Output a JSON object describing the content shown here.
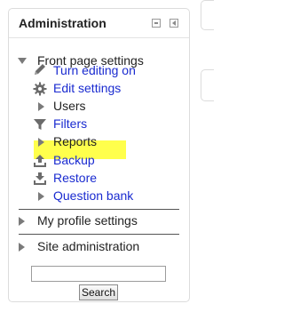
{
  "block": {
    "title": "Administration",
    "front_page": {
      "label": "Front page settings",
      "items": [
        {
          "label": "Turn editing on",
          "icon": "pencil-icon"
        },
        {
          "label": "Edit settings",
          "icon": "gear-icon"
        },
        {
          "label": "Users",
          "icon": "expand-arrow-icon"
        },
        {
          "label": "Filters",
          "icon": "funnel-icon"
        },
        {
          "label": "Reports",
          "icon": "expand-arrow-icon"
        },
        {
          "label": "Backup",
          "icon": "upload-icon"
        },
        {
          "label": "Restore",
          "icon": "download-icon"
        },
        {
          "label": "Question bank",
          "icon": "expand-arrow-icon"
        }
      ]
    },
    "my_profile": {
      "label": "My profile settings"
    },
    "site_admin": {
      "label": "Site administration"
    },
    "search": {
      "button_label": "Search",
      "value": ""
    }
  },
  "colors": {
    "link": "#1a2bd0",
    "highlight": "#ffff4c"
  }
}
